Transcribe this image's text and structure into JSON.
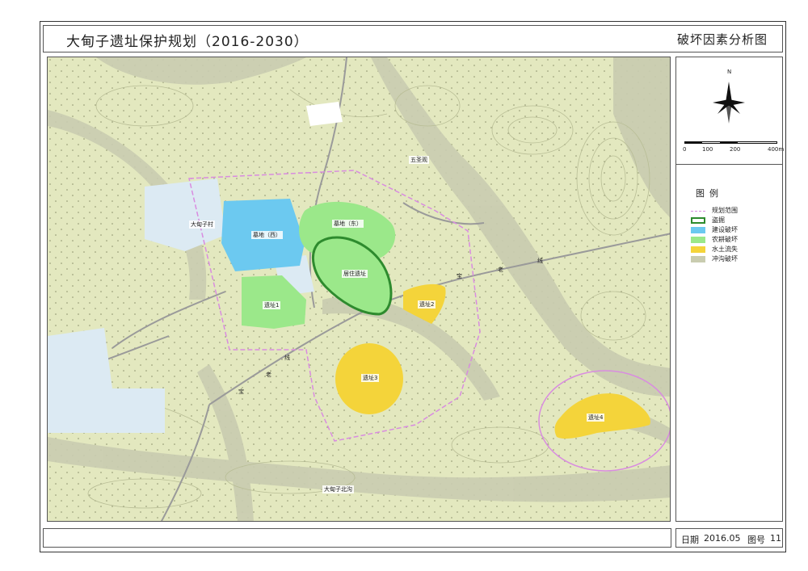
{
  "header": {
    "title": "大甸子遗址保护规划（2016-2030）",
    "subtitle": "破坏因素分析图"
  },
  "footer": {
    "date_label": "日期",
    "date_value": "2016.05",
    "figure_label": "图号",
    "figure_value": "11"
  },
  "compass": {
    "north_label": "N"
  },
  "scale": {
    "ticks": [
      "0",
      "100",
      "200",
      "400m"
    ]
  },
  "legend": {
    "title": "图例",
    "items": [
      {
        "label": "规划范围",
        "color": "#d98ce0"
      },
      {
        "label": "盗掘",
        "color": "#2e8b2e"
      },
      {
        "label": "建设破坏",
        "color": "#6cc9f0"
      },
      {
        "label": "农耕破坏",
        "color": "#9be88a"
      },
      {
        "label": "水土流失",
        "color": "#f4d43a"
      },
      {
        "label": "冲沟破坏",
        "color": "#c9ccb0"
      }
    ]
  },
  "map_labels": {
    "village": "大甸子村",
    "tomb_west": "墓地（西）",
    "tomb_east": "墓地（东）",
    "residence": "居住遗址",
    "site1": "遗址1",
    "site2": "遗址2",
    "site3": "遗址3",
    "site4": "遗址4",
    "temple": "五圣观",
    "gully": "大甸子北沟"
  },
  "road_chars": [
    "线",
    "老",
    "宝",
    "线",
    "老",
    "宝"
  ],
  "colors": {
    "terrain": "#e3e8bf",
    "gully": "#c9ccb0",
    "boundary": "#d98ce0",
    "construction": "#6cc9f0",
    "farming": "#9be88a",
    "erosion": "#f4d43a",
    "looting": "#2e8b2e"
  }
}
